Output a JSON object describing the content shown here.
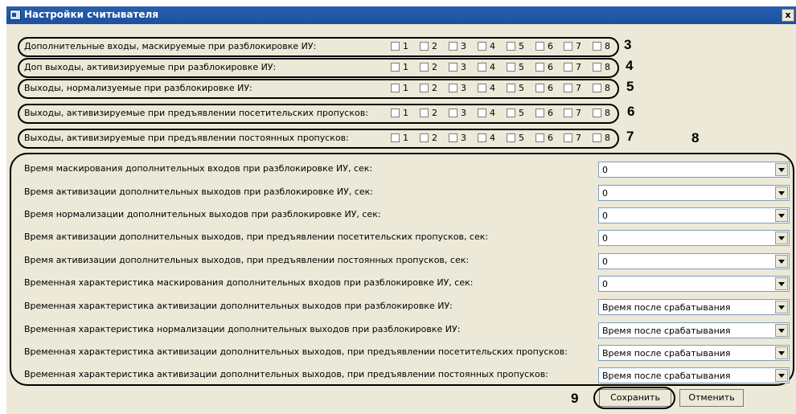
{
  "window": {
    "title": "Настройки считывателя",
    "close_glyph": "x"
  },
  "checkbox_numbers": [
    "1",
    "2",
    "3",
    "4",
    "5",
    "6",
    "7",
    "8"
  ],
  "checkbox_rows": [
    {
      "label": "Дополнительные входы, маскируемые при разблокировке ИУ:",
      "marker": "3"
    },
    {
      "label": "Доп выходы, активизируемые при разблокировке ИУ:",
      "marker": "4"
    },
    {
      "label": "Выходы, нормализуемые при разблокировке ИУ:",
      "marker": "5"
    },
    {
      "label": "Выходы, активизируемые при предъявлении посетительских пропусков:",
      "marker": "6"
    },
    {
      "label": "Выходы, активизируемые при предъявлении постоянных пропусков:",
      "marker": "7"
    }
  ],
  "group_marker": "8",
  "settings": [
    {
      "label": "Время маскирования дополнительных входов при разблокировке ИУ, сек:",
      "value": "0"
    },
    {
      "label": "Время активизации дополнительных выходов при разблокировке ИУ, сек:",
      "value": "0"
    },
    {
      "label": "Время нормализации дополнительных выходов при разблокировке ИУ, сек:",
      "value": "0"
    },
    {
      "label": "Время активизации дополнительных выходов, при предъявлении посетительских пропусков, сек:",
      "value": "0"
    },
    {
      "label": "Время активизации дополнительных выходов, при предъявлении постоянных пропусков, сек:",
      "value": "0"
    },
    {
      "label": "Временная характеристика маскирования дополнительных входов при разблокировке ИУ, сек:",
      "value": "0"
    },
    {
      "label": "Временная характеристика активизации дополнительных выходов при разблокировке ИУ:",
      "value": "Время после срабатывания"
    },
    {
      "label": "Временная характеристика нормализации дополнительных выходов при разблокировке ИУ:",
      "value": "Время после срабатывания"
    },
    {
      "label": "Временная характеристика активизации дополнительных выходов, при предъявлении посетительских пропусков:",
      "value": "Время после срабатывания"
    },
    {
      "label": "Временная характеристика активизации дополнительных выходов, при предъявлении постоянных пропусков:",
      "value": "Время после срабатывания"
    }
  ],
  "footer": {
    "marker": "9",
    "save_label": "Сохранить",
    "cancel_label": "Отменить"
  }
}
